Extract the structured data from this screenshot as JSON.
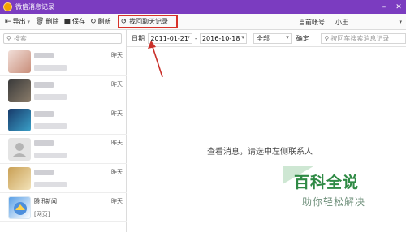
{
  "window": {
    "title": "微信消息记录"
  },
  "toolbar": {
    "export_label": "导出",
    "delete_label": "删除",
    "save_label": "保存",
    "refresh_label": "刷新",
    "recover_label": "找回聊天记录",
    "account_label": "当前帐号",
    "account_value": "小王"
  },
  "sidebar": {
    "search_placeholder": "搜索",
    "contacts": [
      {
        "time": "昨天",
        "avatar": "avatar-1"
      },
      {
        "time": "昨天",
        "avatar": "avatar-2"
      },
      {
        "time": "昨天",
        "avatar": "avatar-3"
      },
      {
        "time": "昨天",
        "avatar": "default-avatar"
      },
      {
        "time": "昨天",
        "avatar": "avatar-5"
      },
      {
        "name": "腾讯新闻",
        "message": "[网页]",
        "time": "昨天",
        "avatar": "tencent-news"
      }
    ]
  },
  "filter": {
    "date_label": "日期",
    "start_date": "2011-01-21",
    "separator": "-",
    "end_date": "2016-10-18",
    "type_value": "全部",
    "confirm_label": "确定",
    "keyword_placeholder": "按回车搜索消息记录"
  },
  "main": {
    "empty_hint": "查看消息，请选中左侧联系人"
  },
  "watermark": {
    "title": "百科全说",
    "subtitle": "助你轻松解决"
  },
  "colors": {
    "titlebar": "#7b3cc0",
    "highlight": "#d8322a",
    "watermark": "#2f8a45"
  }
}
